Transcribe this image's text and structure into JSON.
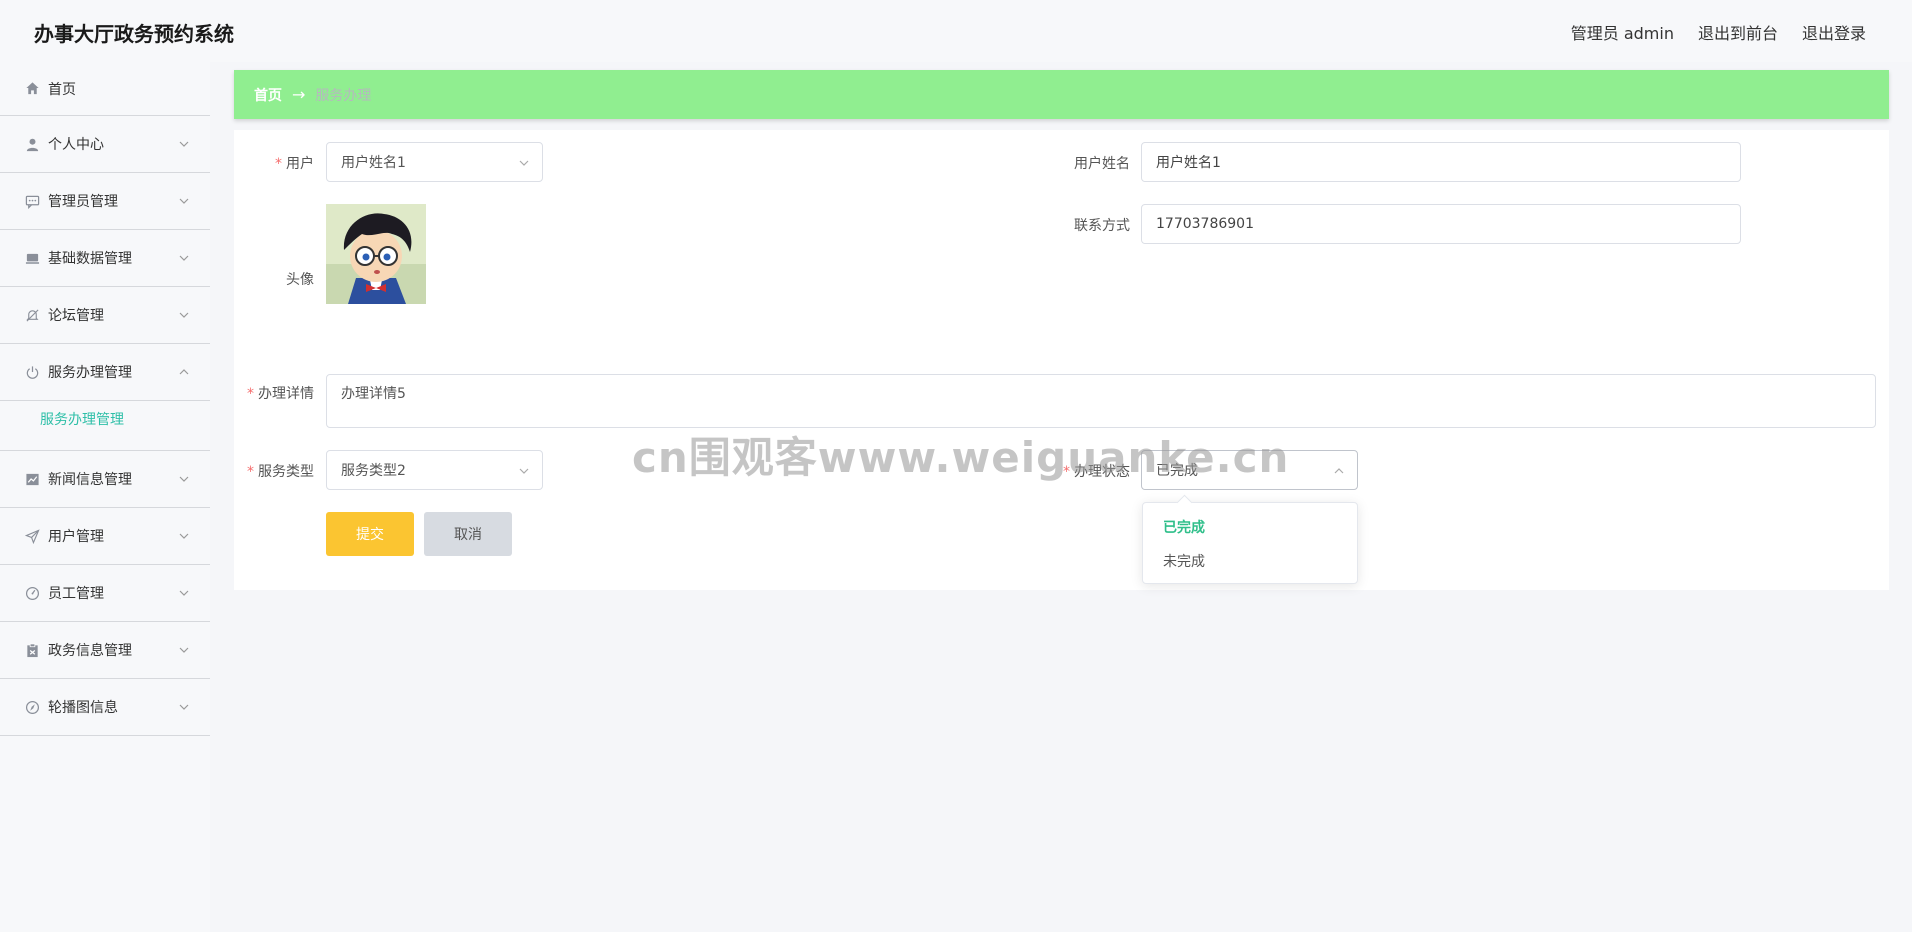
{
  "header": {
    "app_title": "办事大厅政务预约系统",
    "admin_label": "管理员 admin",
    "exit_front": "退出到前台",
    "logout": "退出登录"
  },
  "sidebar": {
    "items": [
      {
        "label": "首页",
        "icon": "home-icon"
      },
      {
        "label": "个人中心",
        "icon": "user-icon"
      },
      {
        "label": "管理员管理",
        "icon": "chat-icon"
      },
      {
        "label": "基础数据管理",
        "icon": "box-icon"
      },
      {
        "label": "论坛管理",
        "icon": "bell-off-icon"
      },
      {
        "label": "服务办理管理",
        "icon": "power-icon",
        "expanded": true,
        "sub": "服务办理管理"
      },
      {
        "label": "新闻信息管理",
        "icon": "chart-icon"
      },
      {
        "label": "用户管理",
        "icon": "send-icon"
      },
      {
        "label": "员工管理",
        "icon": "gauge-icon"
      },
      {
        "label": "政务信息管理",
        "icon": "clipboard-icon"
      },
      {
        "label": "轮播图信息",
        "icon": "compass-icon"
      }
    ]
  },
  "breadcrumb": {
    "home": "首页",
    "separator": "→",
    "current": "服务办理"
  },
  "form": {
    "user_label": "用户",
    "user_value": "用户姓名1",
    "username_label": "用户姓名",
    "username_value": "用户姓名1",
    "avatar_label": "头像",
    "phone_label": "联系方式",
    "phone_value": "17703786901",
    "detail_label": "办理详情",
    "detail_value": "办理详情5",
    "service_type_label": "服务类型",
    "service_type_value": "服务类型2",
    "status_label": "办理状态",
    "status_value": "已完成",
    "submit": "提交",
    "cancel": "取消"
  },
  "status_dropdown": {
    "options": [
      "已完成",
      "未完成"
    ],
    "selected": "已完成"
  },
  "watermark": "cn围观客www.weiguanke.cn",
  "colors": {
    "breadcrumb_bg": "#90ee90",
    "accent": "#2fbfa8",
    "submit": "#fbc531",
    "required": "#f56c6c"
  }
}
